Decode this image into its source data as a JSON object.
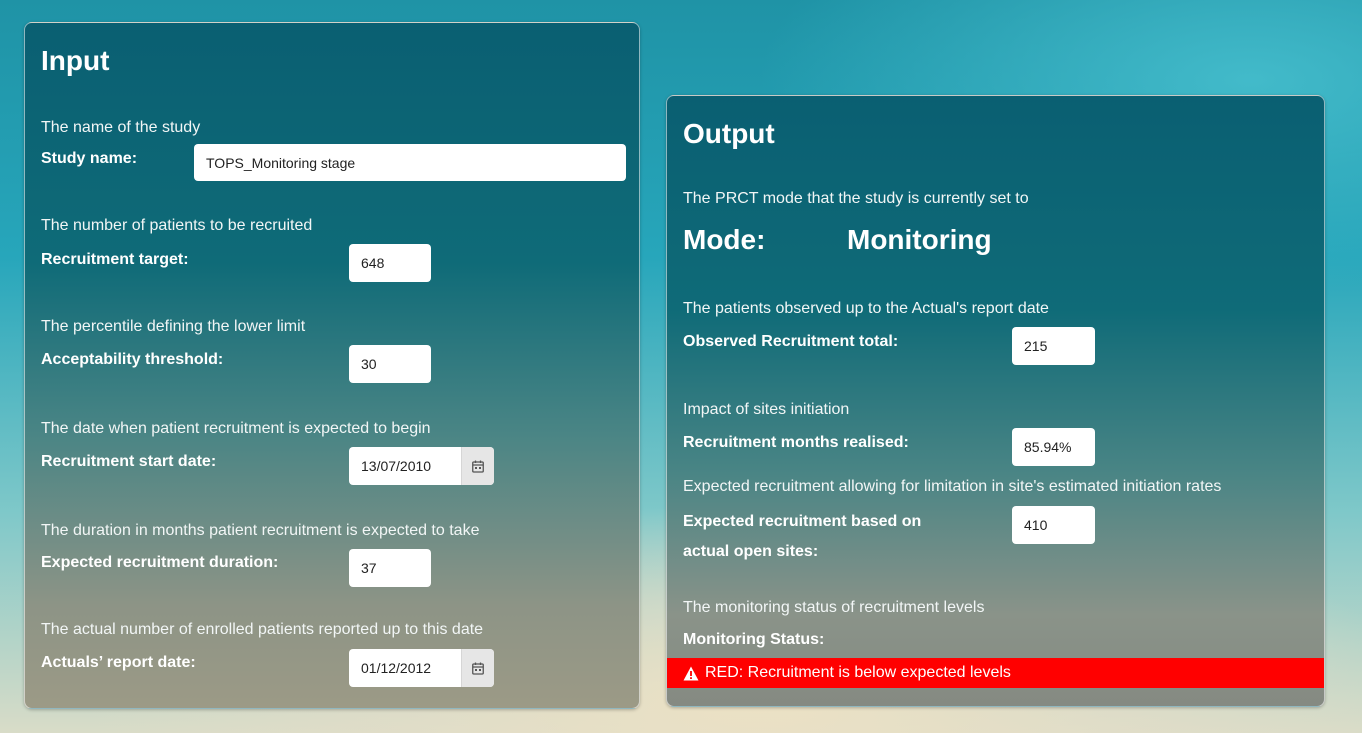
{
  "input": {
    "title": "Input",
    "study_name": {
      "desc": "The name of the study",
      "label": "Study name:",
      "value": "TOPS_Monitoring stage"
    },
    "recruitment_target": {
      "desc": "The number of patients to be recruited",
      "label": "Recruitment target:",
      "value": "648"
    },
    "acceptability_threshold": {
      "desc": "The percentile defining the lower limit",
      "label": "Acceptability threshold:",
      "value": "30"
    },
    "recruitment_start_date": {
      "desc": "The date when patient recruitment is expected to begin",
      "label": "Recruitment start date:",
      "value": "13/07/2010",
      "icon": "calendar-icon"
    },
    "expected_duration": {
      "desc": "The duration in months patient recruitment is expected to take",
      "label": "Expected recruitment duration:",
      "value": "37"
    },
    "actuals_report_date": {
      "desc": "The actual number of enrolled patients reported up to this date",
      "label": "Actuals’ report date:",
      "value": "01/12/2012",
      "icon": "calendar-icon"
    }
  },
  "output": {
    "title": "Output",
    "mode_desc": "The PRCT mode that the study is currently set to",
    "mode_label": "Mode:",
    "mode_value": "Monitoring",
    "observed_total": {
      "desc": "The patients observed up to the Actual's report date",
      "label": "Observed Recruitment total:",
      "value": "215"
    },
    "months_realised": {
      "desc": "Impact of sites initiation",
      "label": "Recruitment months realised:",
      "value": "85.94%"
    },
    "expected_recruitment": {
      "desc": "Expected recruitment allowing for limitation in site's estimated initiation rates",
      "label_line1": "Expected recruitment based on",
      "label_line2": "actual open sites:",
      "value": "410"
    },
    "monitoring_status": {
      "desc": "The monitoring status of recruitment levels",
      "label": "Monitoring Status:",
      "status_text": "RED: Recruitment is below expected levels",
      "status_color": "#ff0000",
      "icon": "warning-icon"
    }
  }
}
